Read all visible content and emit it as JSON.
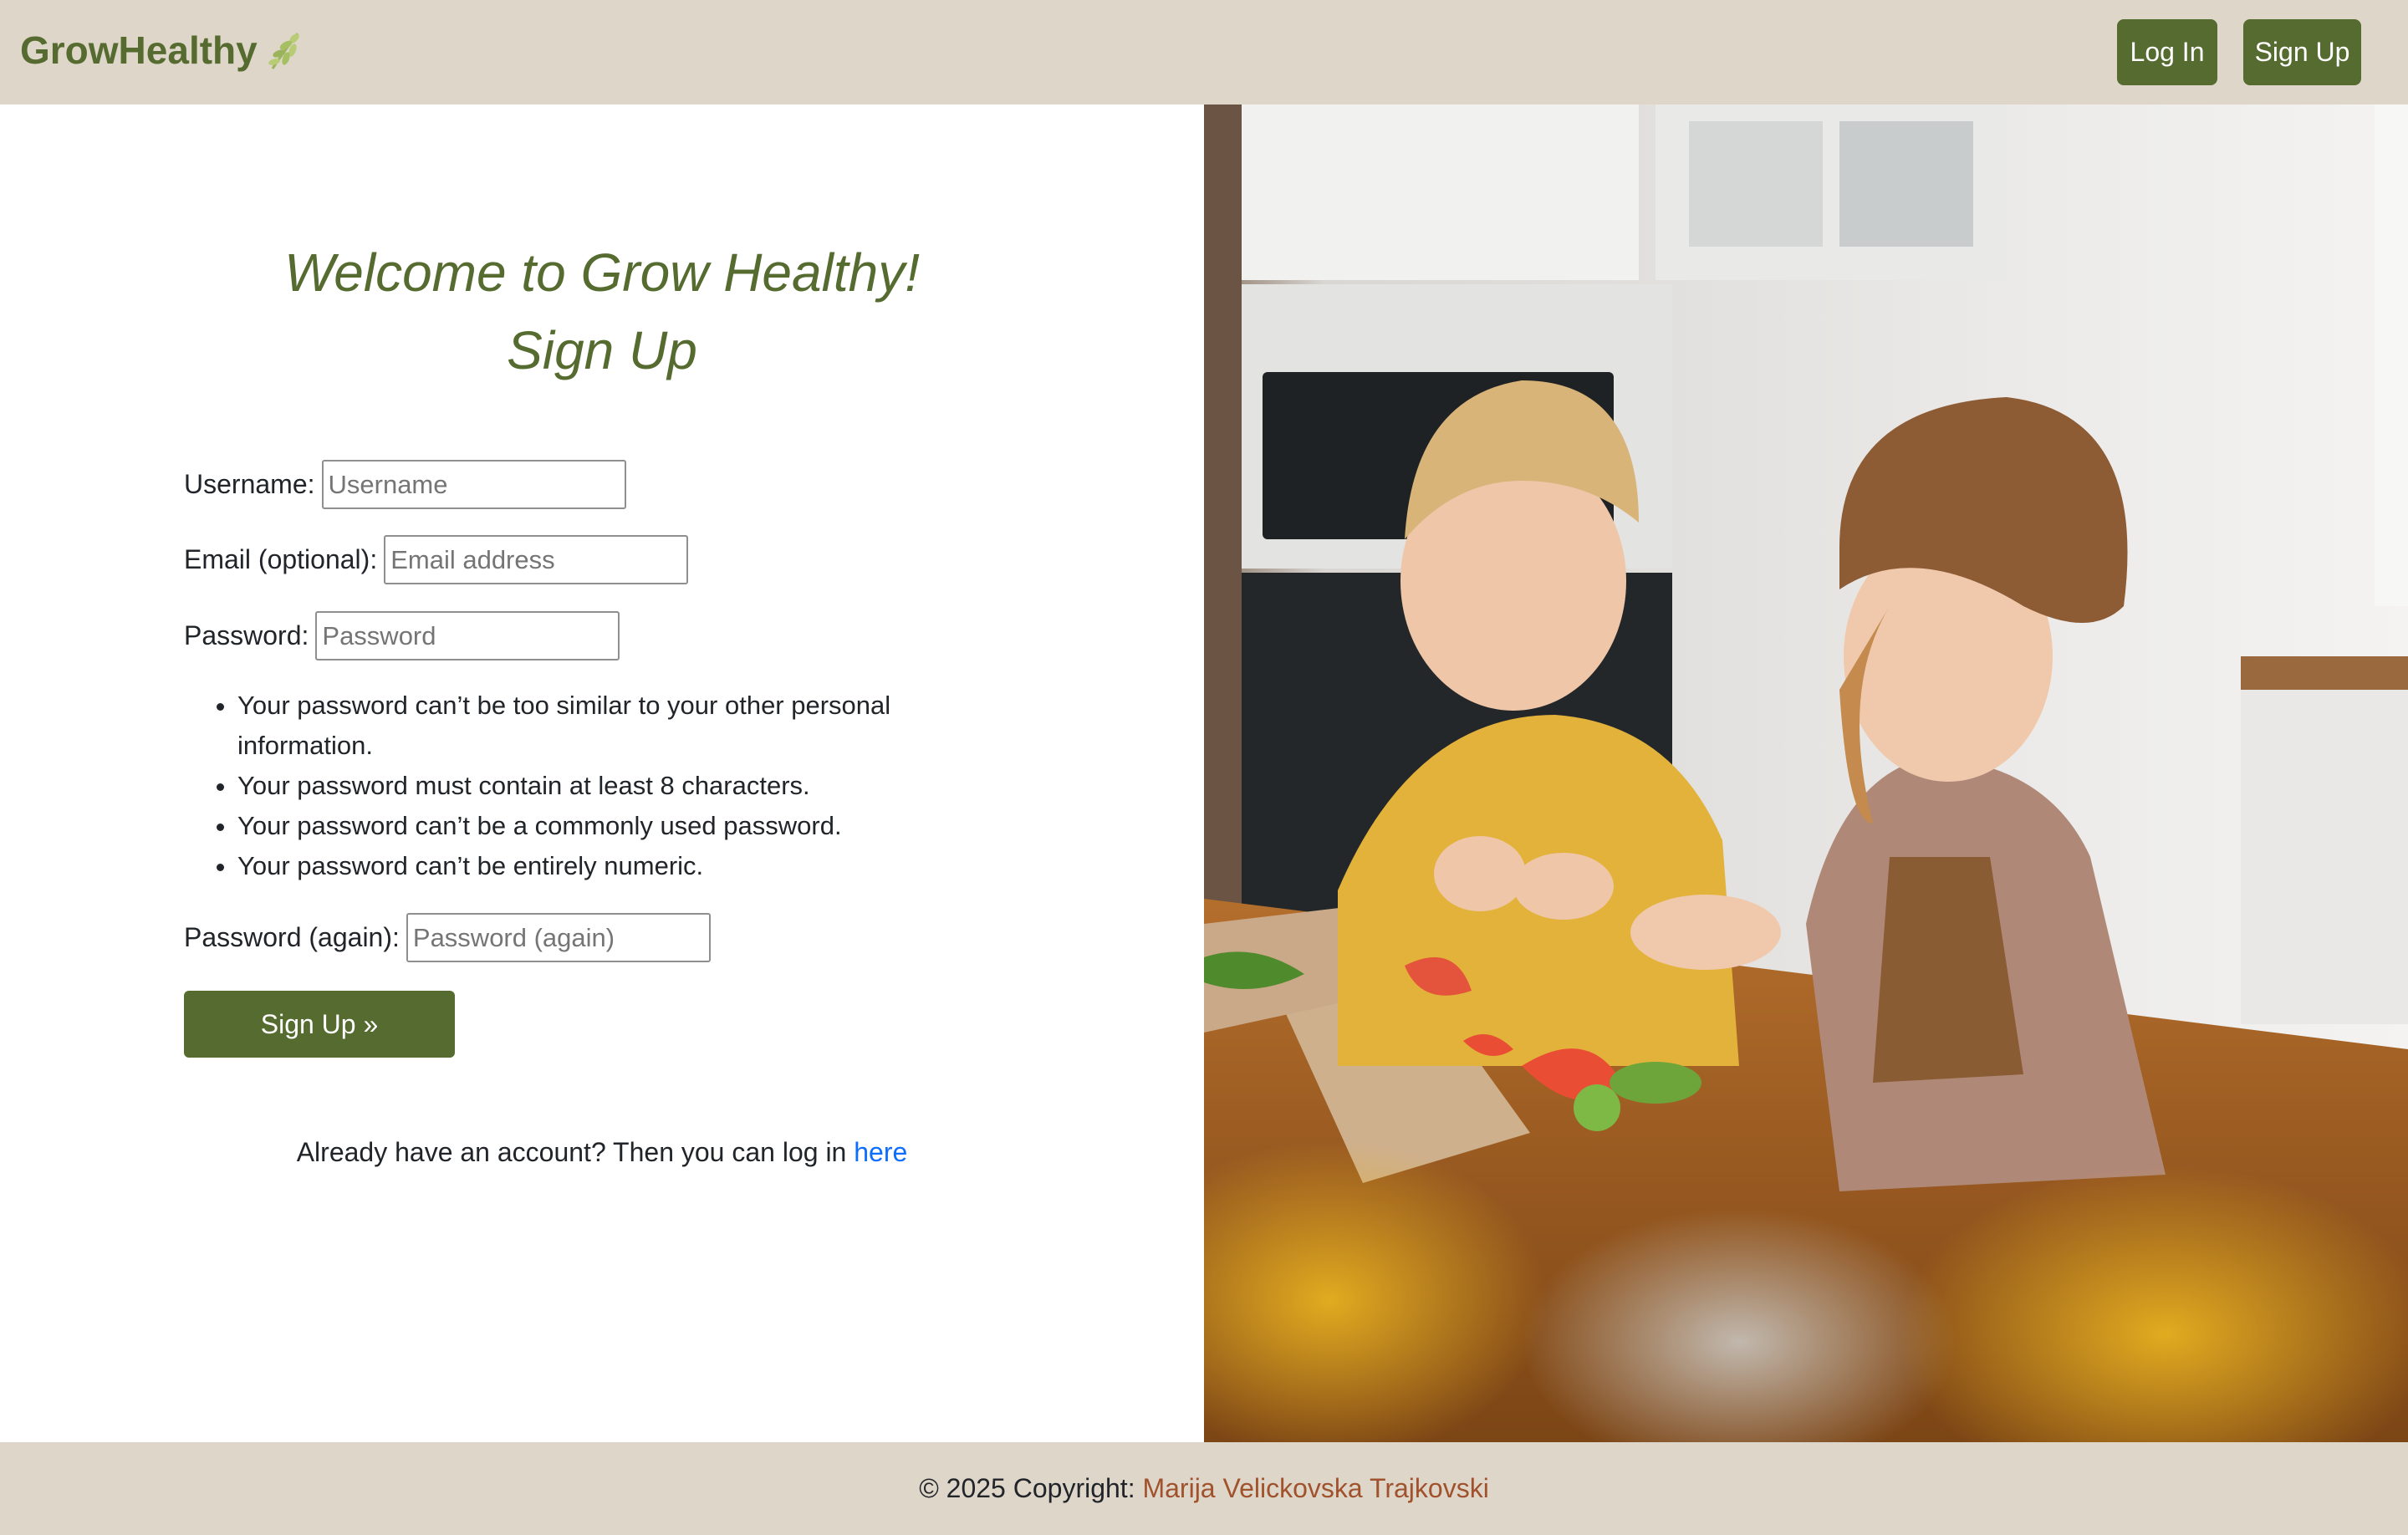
{
  "header": {
    "brand": "GrowHealthy",
    "brand_icon": "leaf-sprig-icon",
    "login_label": "Log In",
    "signup_label": "Sign Up"
  },
  "main": {
    "title_line1": "Welcome to Grow Healthy!",
    "title_line2": "Sign Up",
    "form": {
      "username": {
        "label": "Username:",
        "placeholder": "Username",
        "value": ""
      },
      "email": {
        "label": "Email (optional):",
        "placeholder": "Email address",
        "value": ""
      },
      "password": {
        "label": "Password:",
        "placeholder": "Password",
        "value": ""
      },
      "password_rules": [
        "Your password can’t be too similar to your other personal information.",
        "Your password must contain at least 8 characters.",
        "Your password can’t be a commonly used password.",
        "Your password can’t be entirely numeric."
      ],
      "password_again": {
        "label": "Password (again):",
        "placeholder": "Password (again)",
        "value": ""
      },
      "submit_label": "Sign Up »"
    },
    "login_prompt": {
      "text": "Already have an account? Then you can log in ",
      "link_text": "here"
    }
  },
  "image": {
    "description_icon": "kids-cooking-photo"
  },
  "footer": {
    "copyright": "© 2025 Copyright: ",
    "author": "Marija Velickovska Trajkovski"
  },
  "colors": {
    "brand_green": "#556b2f",
    "header_bg": "#dfd6ca",
    "link_blue": "#0d6efd",
    "author_brown": "#a0522d"
  }
}
